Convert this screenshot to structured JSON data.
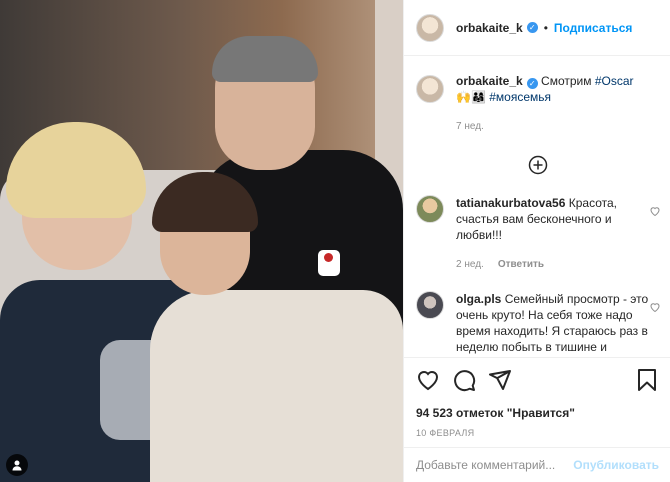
{
  "post": {
    "author": "orbakaite_k",
    "follow_label": "Подписаться",
    "caption_text": "Смотрим",
    "caption_tag1": "#Oscar",
    "caption_emoji": "🙌👨‍👩‍👧",
    "caption_tag2": "#моясемья",
    "caption_age": "7 нед.",
    "likes": "94 523 отметок \"Нравится\"",
    "date": "10 ФЕВРАЛЯ"
  },
  "comments": [
    {
      "user": "tatianakurbatova56",
      "text": "Красота, счастья вам бесконечного и любви!!!",
      "age": "2 нед.",
      "reply": "Ответить"
    },
    {
      "user": "olga.pls",
      "text": "Семейный просмотр - это очень круто! На себя тоже надо время находить! Я стараюсь раз в неделю побыть в тишине и почитать портал"
    }
  ],
  "composer": {
    "placeholder": "Добавьте комментарий...",
    "publish_label": "Опубликовать"
  },
  "icons": {
    "load_more": "plus-circle-icon",
    "like": "heart-icon",
    "comment": "comment-icon",
    "share": "paper-plane-icon",
    "save": "bookmark-icon",
    "tag": "person-icon",
    "verified": "verified-badge-icon"
  },
  "colors": {
    "link_blue": "#0095f6",
    "verified_blue": "#3897f0",
    "hashtag": "#00376b",
    "muted": "#8e8e8e",
    "publish_disabled": "#b2dffc"
  }
}
